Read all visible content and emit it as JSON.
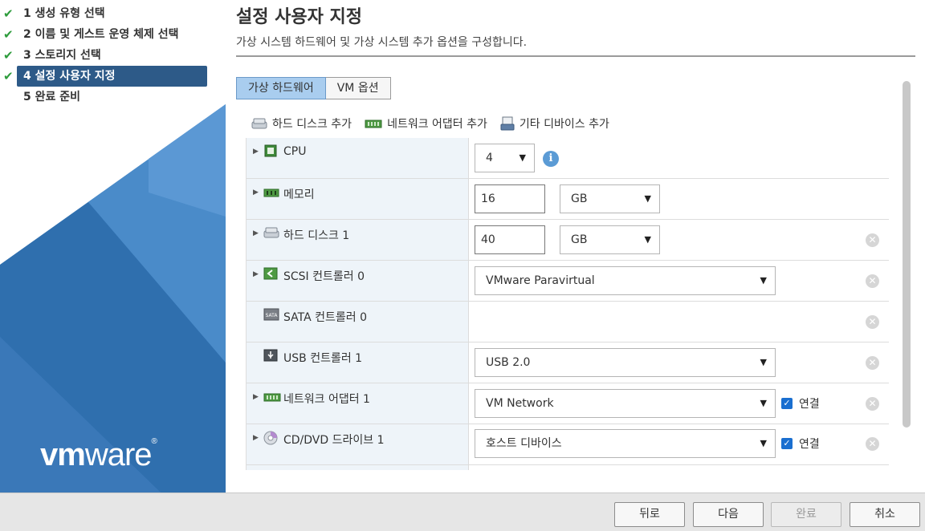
{
  "steps": [
    {
      "number": "1",
      "label": "생성 유형 선택",
      "done": true
    },
    {
      "number": "2",
      "label": "이름 및 게스트 운영 체제 선택",
      "done": true
    },
    {
      "number": "3",
      "label": "스토리지 선택",
      "done": true
    },
    {
      "number": "4",
      "label": "설정 사용자 지정",
      "done": true,
      "active": true
    },
    {
      "number": "5",
      "label": "완료 준비",
      "done": false
    }
  ],
  "logo": {
    "vm": "vm",
    "ware": "ware",
    "reg": "®"
  },
  "page": {
    "title": "설정 사용자 지정",
    "description": "가상 시스템 하드웨어 및 가상 시스템 추가 옵션을 구성합니다."
  },
  "tabs": [
    {
      "label": "가상 하드웨어",
      "active": true
    },
    {
      "label": "VM 옵션",
      "active": false
    }
  ],
  "toolbar": {
    "add_hard_disk": "하드 디스크 추가",
    "add_network_adapter": "네트워크 어댑터 추가",
    "add_other_device": "기타 디바이스 추가"
  },
  "hardware": {
    "cpu": {
      "label": "CPU",
      "value": "4"
    },
    "memory": {
      "label": "메모리",
      "value": "16",
      "unit": "GB"
    },
    "hard_disk": {
      "label": "하드 디스크 1",
      "value": "40",
      "unit": "GB"
    },
    "scsi": {
      "label": "SCSI 컨트롤러 0",
      "value": "VMware Paravirtual"
    },
    "sata": {
      "label": "SATA 컨트롤러 0"
    },
    "usb": {
      "label": "USB 컨트롤러 1",
      "value": "USB 2.0"
    },
    "network": {
      "label": "네트워크 어댑터 1",
      "value": "VM Network",
      "connect_label": "연결"
    },
    "cdrom": {
      "label": "CD/DVD 드라이브 1",
      "value": "호스트 디바이스",
      "connect_label": "연결"
    }
  },
  "footer": {
    "back": "뒤로",
    "next": "다음",
    "finish": "완료",
    "cancel": "취소"
  },
  "colors": {
    "active_step": "#2d5a88",
    "sidebar_blue": "#2f6fae",
    "active_tab": "#a9cdef",
    "checkbox": "#1a6fd0"
  }
}
